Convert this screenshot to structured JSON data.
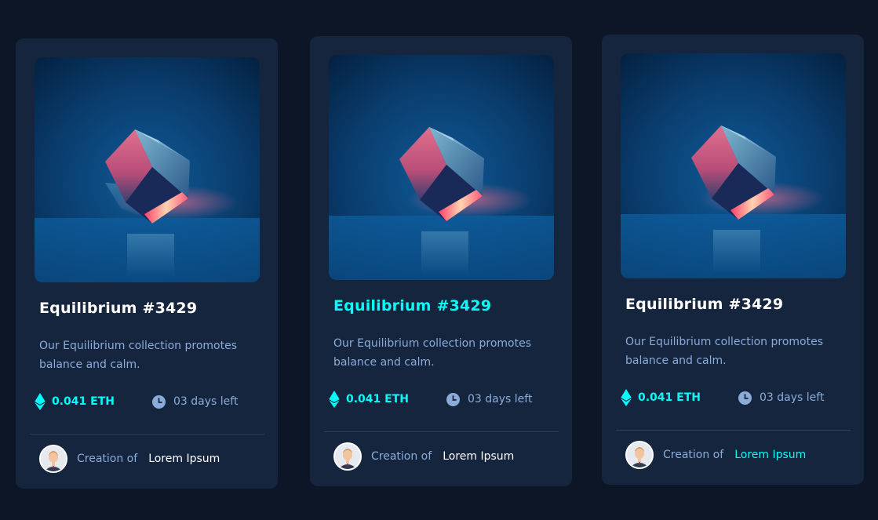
{
  "cards": [
    {
      "title": "Equilibrium #3429",
      "description": "Our Equilibrium collection promotes balance and calm.",
      "price": "0.041 ETH",
      "time_left": "03 days left",
      "creator_prefix": "Creation of",
      "creator_name": "Lorem Ipsum"
    },
    {
      "title": "Equilibrium #3429",
      "description": "Our Equilibrium collection promotes balance and calm.",
      "price": "0.041 ETH",
      "time_left": "03 days left",
      "creator_prefix": "Creation of",
      "creator_name": "Lorem Ipsum"
    },
    {
      "title": "Equilibrium #3429",
      "description": "Our Equilibrium collection promotes balance and calm.",
      "price": "0.041 ETH",
      "time_left": "03 days left",
      "creator_prefix": "Creation of",
      "creator_name": "Lorem Ipsum"
    }
  ],
  "colors": {
    "background": "#0d1627",
    "card": "#15253e",
    "accent": "#00fff8",
    "muted_text": "#8bacd9",
    "divider": "#2e405a"
  },
  "icons": {
    "price": "ethereum-icon",
    "time": "clock-icon",
    "creator": "avatar"
  }
}
